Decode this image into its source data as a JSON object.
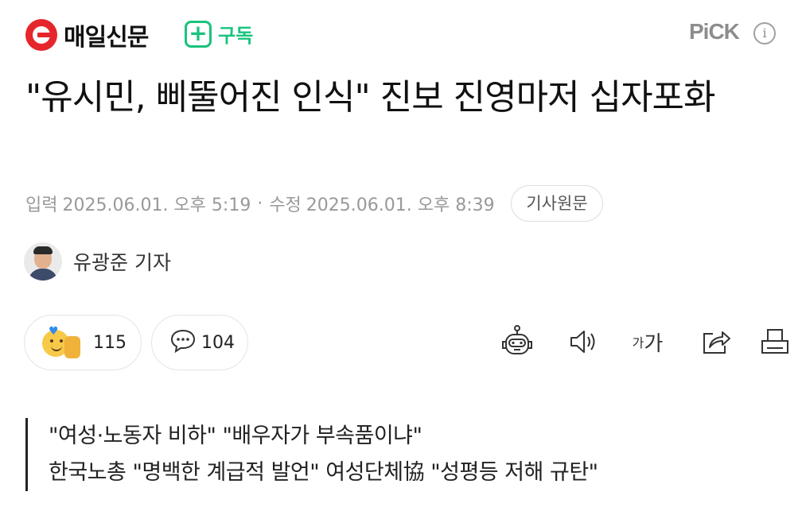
{
  "header": {
    "logo_text": "매일신문",
    "subscribe_label": "구독",
    "pick_label": "PiCK",
    "info_label": "i"
  },
  "article": {
    "headline": "\"유시민, 삐뚤어진 인식\" 진보 진영마저 십자포화",
    "published_label": "입력",
    "published": "2025.06.01. 오후 5:19",
    "modified_label": "수정",
    "modified": "2025.06.01. 오후 8:39",
    "meta_separator": "·",
    "original_button": "기사원문"
  },
  "reporter": {
    "name": "유광준 기자"
  },
  "reactions": {
    "like_count": "115",
    "comment_count": "104"
  },
  "tools": {
    "font_small": "가",
    "font_big": "가",
    "icons": [
      "robot-summary-icon",
      "speaker-icon",
      "font-size-icon",
      "share-icon",
      "print-icon"
    ]
  },
  "summary": {
    "lines": [
      "\"여성·노동자 비하\" \"배우자가 부속품이냐\"",
      "한국노총 \"명백한 계급적 발언\" 여성단체協 \"성평등 저해 규탄\""
    ]
  },
  "colors": {
    "brand_red": "#e5262b",
    "subscribe_green": "#19c37d",
    "muted_gray": "#999999"
  }
}
